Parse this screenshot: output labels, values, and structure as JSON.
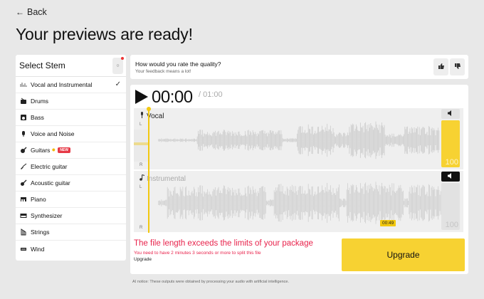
{
  "nav": {
    "back_label": "Back"
  },
  "page_title": "Your previews are ready!",
  "stems": {
    "title": "Select Stem",
    "items": [
      {
        "label": "Vocal and Instrumental",
        "icon": "vocal-instrumental-icon",
        "selected": true
      },
      {
        "label": "Drums",
        "icon": "drum-icon"
      },
      {
        "label": "Bass",
        "icon": "amplifier-icon"
      },
      {
        "label": "Voice and Noise",
        "icon": "microphone-icon"
      },
      {
        "label": "Guitars",
        "icon": "guitar-icon",
        "badge": "NEW"
      },
      {
        "label": "Electric guitar",
        "icon": "electric-guitar-icon"
      },
      {
        "label": "Acoustic guitar",
        "icon": "acoustic-guitar-icon"
      },
      {
        "label": "Piano",
        "icon": "piano-icon"
      },
      {
        "label": "Synthesizer",
        "icon": "synthesizer-icon"
      },
      {
        "label": "Strings",
        "icon": "harp-icon"
      },
      {
        "label": "Wind",
        "icon": "wind-instrument-icon"
      }
    ]
  },
  "feedback": {
    "question": "How would you rate the quality?",
    "subtext": "Your feedback means a lot!"
  },
  "player": {
    "current_time": "00:00",
    "duration": "/ 01:00",
    "tracks": [
      {
        "name": "Vocal",
        "volume": "100",
        "muted": false,
        "left": "L",
        "right": "R"
      },
      {
        "name": "Instrumental",
        "volume": "100",
        "muted": true,
        "left": "L",
        "right": "R"
      }
    ],
    "marker": "00:49"
  },
  "limit": {
    "error": "The file length exceeds the limits of your package",
    "detail": "You need to have 2 minutes 3 seconds or more to split this file",
    "package": "Upgrade",
    "upgrade_button": "Upgrade"
  },
  "ai_notice": "AI notice: These outputs were obtained by processing your audio with artificial intelligence.",
  "colors": {
    "accent": "#f7d232",
    "error": "#e8224b",
    "background": "#e8e8e8"
  }
}
